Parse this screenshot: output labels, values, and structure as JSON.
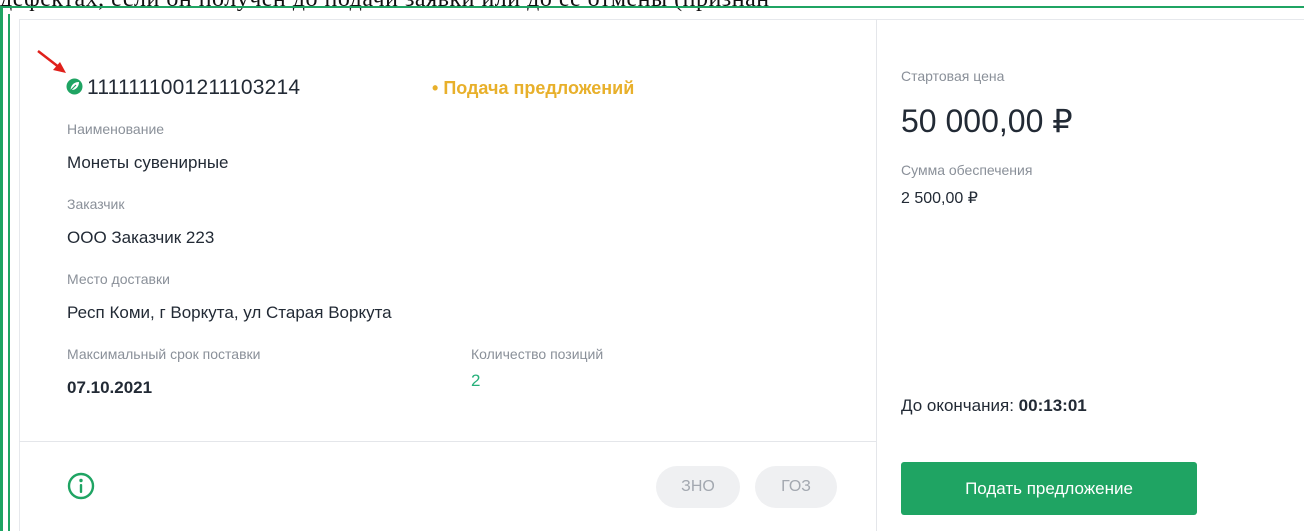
{
  "top_strip_text": "дефектах, если он получен до подачи заявки или до ее отмены (признан",
  "tender": {
    "registry_number": "1111111001211103214",
    "status": "Подача предложений",
    "name_label": "Наименование",
    "name_value": "Монеты сувенирные",
    "customer_label": "Заказчик",
    "customer_value": "ООО Заказчик 223",
    "delivery_label": "Место доставки",
    "delivery_value": "Респ Коми, г Воркута, ул Старая Воркута",
    "max_term_label": "Максимальный срок поставки",
    "max_term_value": "07.10.2021",
    "positions_label": "Количество позиций",
    "positions_value": "2"
  },
  "footer": {
    "info_icon": "info-circle-icon",
    "chip_zno": "ЗНО",
    "chip_goz": "ГОЗ"
  },
  "pricing": {
    "start_price_label": "Стартовая цена",
    "start_price_value": "50 000,00 ₽",
    "security_label": "Сумма обеспечения",
    "security_value": "2 500,00 ₽",
    "deadline_label": "До окончания:",
    "deadline_value": "00:13:01",
    "submit_label": "Подать предложение"
  },
  "colors": {
    "accent_green": "#1fa463",
    "status_yellow": "#e8b02b",
    "count_green": "#26b07a",
    "annotation_red": "#e0201b"
  },
  "icons": {
    "annotation": "red-arrow-icon",
    "tender_type": "leaf-badge-icon"
  }
}
